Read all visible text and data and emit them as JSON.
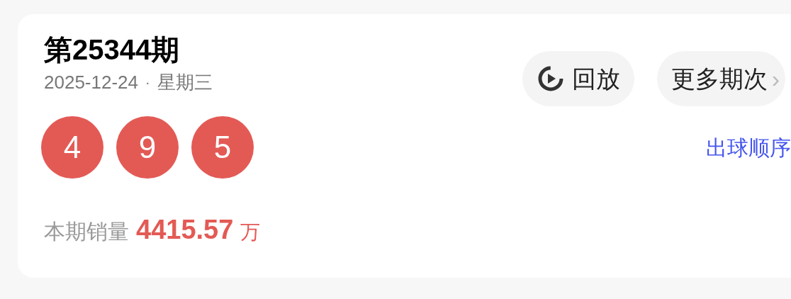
{
  "issue": {
    "title": "第25344期",
    "date": "2025-12-24",
    "separator": "·",
    "weekday": "星期三"
  },
  "buttons": [
    {
      "kind": "replay",
      "label": "回放"
    },
    {
      "kind": "more",
      "label": "更多期次",
      "chevron": "›"
    }
  ],
  "balls": [
    "4",
    "9",
    "5"
  ],
  "order_link": "出球顺序",
  "sales": {
    "label": "本期销量",
    "value": "4415.57",
    "unit": "万"
  }
}
